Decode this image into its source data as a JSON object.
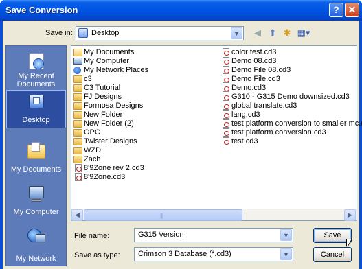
{
  "window": {
    "title": "Save Conversion",
    "help_glyph": "?",
    "close_glyph": "✕"
  },
  "savein": {
    "label": "Save in:",
    "value": "Desktop"
  },
  "toolbar": {
    "back_glyph": "◀",
    "up_glyph": "⬆",
    "newfolder_glyph": "✱",
    "views_glyph": "▦▾"
  },
  "places": [
    {
      "label": "My Recent Documents"
    },
    {
      "label": "Desktop"
    },
    {
      "label": "My Documents"
    },
    {
      "label": "My Computer"
    },
    {
      "label": "My Network"
    }
  ],
  "files_col1": [
    {
      "name": "My Documents",
      "icon": "my-documents-icon"
    },
    {
      "name": "My Computer",
      "icon": "my-computer-icon"
    },
    {
      "name": "My Network Places",
      "icon": "my-network-icon"
    },
    {
      "name": "c3",
      "icon": "folder-icon"
    },
    {
      "name": "C3 Tutorial",
      "icon": "folder-icon"
    },
    {
      "name": "FJ Designs",
      "icon": "folder-icon"
    },
    {
      "name": "Formosa Designs",
      "icon": "folder-icon"
    },
    {
      "name": "New Folder",
      "icon": "folder-icon"
    },
    {
      "name": "New Folder (2)",
      "icon": "folder-icon"
    },
    {
      "name": "OPC",
      "icon": "folder-icon"
    },
    {
      "name": "Twister Designs",
      "icon": "folder-icon"
    },
    {
      "name": "WZD",
      "icon": "folder-icon"
    },
    {
      "name": "Zach",
      "icon": "folder-icon"
    },
    {
      "name": "8'9Zone rev 2.cd3",
      "icon": "cd3-file-icon"
    },
    {
      "name": "8'9Zone.cd3",
      "icon": "cd3-file-icon"
    }
  ],
  "files_col2": [
    {
      "name": "color test.cd3",
      "icon": "cd3-file-icon"
    },
    {
      "name": "Demo 08.cd3",
      "icon": "cd3-file-icon"
    },
    {
      "name": "Demo File 08.cd3",
      "icon": "cd3-file-icon"
    },
    {
      "name": "Demo File.cd3",
      "icon": "cd3-file-icon"
    },
    {
      "name": "Demo.cd3",
      "icon": "cd3-file-icon"
    },
    {
      "name": "G310 - G315 Demo downsized.cd3",
      "icon": "cd3-file-icon"
    },
    {
      "name": "global translate.cd3",
      "icon": "cd3-file-icon"
    },
    {
      "name": "lang.cd3",
      "icon": "cd3-file-icon"
    },
    {
      "name": "test platform conversion to smaller mc.cd",
      "icon": "cd3-file-icon"
    },
    {
      "name": "test platform conversion.cd3",
      "icon": "cd3-file-icon"
    },
    {
      "name": "test.cd3",
      "icon": "cd3-file-icon"
    }
  ],
  "filename": {
    "label": "File name:",
    "value": "G315 Version"
  },
  "savetype": {
    "label": "Save as type:",
    "value": "Crimson 3 Database (*.cd3)"
  },
  "buttons": {
    "save": "Save",
    "cancel": "Cancel"
  },
  "scroll": {
    "left_glyph": "◀",
    "right_glyph": "▶",
    "grip": "|||"
  }
}
